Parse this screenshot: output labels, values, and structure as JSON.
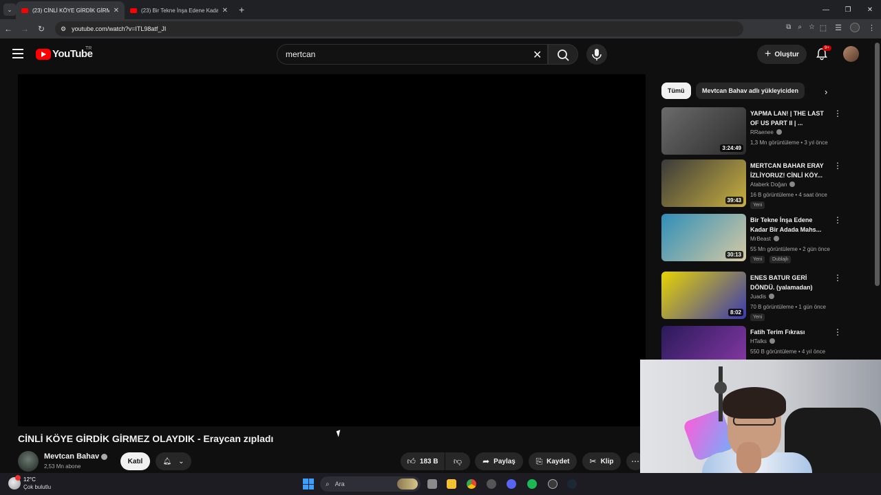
{
  "browser": {
    "tabs": [
      {
        "title": "(23) CİNLİ KÖYE GİRDİK GİRME",
        "active": true
      },
      {
        "title": "(23) Bir Tekne İnşa Edene Kada",
        "active": false
      }
    ],
    "url": "youtube.com/watch?v=ITL98atf_JI"
  },
  "youtube": {
    "logo_text": "YouTube",
    "region": "TR",
    "search_value": "mertcan",
    "create_label": "Oluştur",
    "notif_count": "9+"
  },
  "video": {
    "title": "CİNLİ KÖYE GİRDİK GİRMEZ OLAYDIK - Eraycan zıpladı",
    "channel": "Mevtcan Bahav",
    "subscribers": "2,53 Mn abone",
    "join_label": "Katıl",
    "likes": "183 B",
    "share_label": "Paylaş",
    "save_label": "Kaydet",
    "clip_label": "Klip"
  },
  "sidebar": {
    "chips": [
      "Tümü",
      "Mevtcan Bahav adlı yükleyiciden"
    ],
    "videos": [
      {
        "title": "YAPMA LAN! | THE LAST OF US PART II | ...",
        "channel": "RRaenee",
        "meta": "1,3 Mn görüntüleme • 3 yıl önce",
        "duration": "3:24:49",
        "tags": [],
        "thumb": [
          "#6b6b6b",
          "#2b2b2b"
        ]
      },
      {
        "title": "MERTCAN BAHAR ERAY İZLİYORUZ! CİNLİ KÖY...",
        "channel": "Ataberk Doğan",
        "meta": "16 B görüntüleme • 4 saat önce",
        "duration": "39:43",
        "tags": [
          "Yeni"
        ],
        "thumb": [
          "#3a3a3a",
          "#c9b040"
        ]
      },
      {
        "title": "Bir Tekne İnşa Edene Kadar Bir Adada Mahs...",
        "channel": "MrBeast",
        "meta": "55 Mn görüntüleme • 2 gün önce",
        "duration": "30:13",
        "tags": [
          "Yeni",
          "Dublajlı"
        ],
        "thumb": [
          "#2f8fb8",
          "#d7c9a4"
        ]
      },
      {
        "title": "ENES BATUR GERİ DÖNDÜ. (yalamadan)",
        "channel": "Juadis",
        "meta": "70 B görüntüleme • 1 gün önce",
        "duration": "8:02",
        "tags": [
          "Yeni"
        ],
        "thumb": [
          "#e8d400",
          "#3a3ab0"
        ]
      },
      {
        "title": "Fatih Terim Fıkrası",
        "channel": "HTalks",
        "meta": "550 B görüntüleme • 4 yıl önce",
        "duration": "",
        "tags": [],
        "thumb": [
          "#2a1a5a",
          "#8a3aa8"
        ]
      }
    ]
  },
  "taskbar": {
    "temperature": "12°C",
    "condition": "Çok bulutlu",
    "search_placeholder": "Ara"
  }
}
